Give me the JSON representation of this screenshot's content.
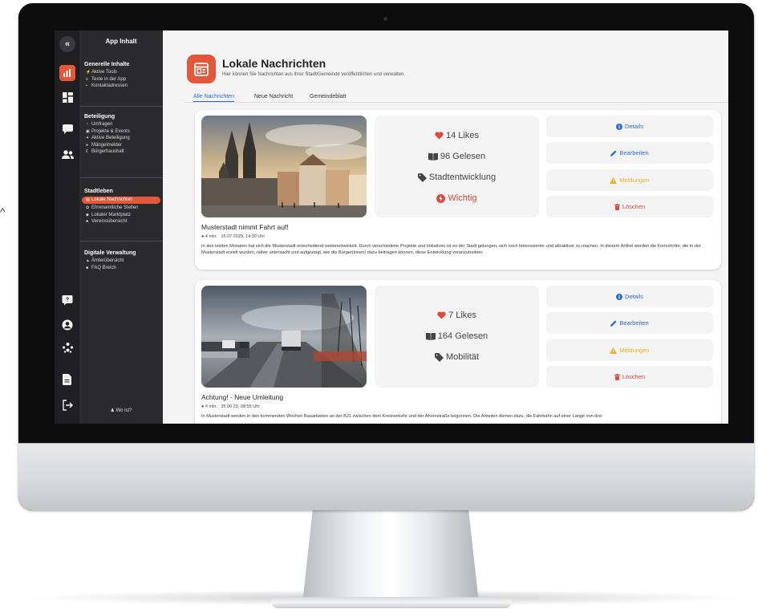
{
  "sidebar": {
    "title": "App Inhalt",
    "sections": [
      {
        "heading": "Generelle Inhalte",
        "items": [
          {
            "label": "Aktive Tools",
            "icon": "dot-icon"
          },
          {
            "label": "Texte in der App",
            "icon": "text-icon"
          },
          {
            "label": "Kontaktadressen",
            "icon": "contact-icon"
          }
        ]
      },
      {
        "heading": "Beteiligung",
        "items": [
          {
            "label": "Umfragen",
            "icon": "poll-icon"
          },
          {
            "label": "Projekte & Events",
            "icon": "calendar-icon"
          },
          {
            "label": "Aktive Beteiligung",
            "icon": "person-icon"
          },
          {
            "label": "Mängelmelder",
            "icon": "alert-icon"
          },
          {
            "label": "Bürgerhaushalt",
            "icon": "euro-icon"
          }
        ]
      },
      {
        "heading": "Stadtleben",
        "items": [
          {
            "label": "Lokale Nachrichten",
            "icon": "news-icon",
            "active": true
          },
          {
            "label": "Ehrenamtliche Stellen",
            "icon": "handshake-icon"
          },
          {
            "label": "Lokaler Marktplatz",
            "icon": "shop-icon"
          },
          {
            "label": "Vereinsübersicht",
            "icon": "group-icon"
          }
        ]
      },
      {
        "heading": "Digitale Verwaltung",
        "items": [
          {
            "label": "Ämterübersicht",
            "icon": "building-icon"
          },
          {
            "label": "FAQ Breich",
            "icon": "faq-icon"
          }
        ]
      }
    ],
    "footer": "Wo ist?"
  },
  "header": {
    "title": "Lokale Nachrichten",
    "subtitle": "Hier können Sie Nachrichten aus Ihrer Stadt/Gemeinde veröffentlichen und verwalten.",
    "tabs": [
      "Alle Nachrichten",
      "Neue Nachricht",
      "Gemeindeblatt"
    ],
    "active_tab": 0
  },
  "actions": {
    "details": "Details",
    "edit": "Bearbeiten",
    "reports": "Meldungen",
    "delete": "Löschen"
  },
  "news": [
    {
      "likes": "14 Likes",
      "reads": "96 Gelesen",
      "category": "Stadtentwicklung",
      "flag": "Wichtig",
      "title": "Musterstadt nimmt Fahrt auf!",
      "read_time": "4 min.",
      "date": "15.07.2023, 14:30 Uhr",
      "body": "In den letzten Monaten hat sich die Musterstadt entscheidend weiterentwickelt. Durch verschiedene Projekte und Initiativen ist es der Stadt gelungen, sich noch lebenswerter und attraktiver zu machen. In diesem Artikel werden die Fortschritte, die in der Musterstadt erzielt wurden, näher untersucht und aufgezeigt, wie die Bürger(innen) dazu beitragen können, diese Entwicklung voranzutreiben."
    },
    {
      "likes": "7 Likes",
      "reads": "164 Gelesen",
      "category": "Mobilität",
      "title": "Achtung! - Neue Umleitung",
      "read_time": "4 min.",
      "date": "25.06.23, 08:55 Uhr",
      "body": "In Musterstadt werden in den kommenden Wochen Bauarbeiten an der B21 zwischen dem Kreisverkehr und der Ahornstraße begonnen. Die Arbeiten dienen dazu, die Fahrbahn auf einer Länge von drei"
    }
  ],
  "colors": {
    "accent": "#e3573b",
    "link_blue": "#2f6bd6",
    "warning_yellow": "#efb31a",
    "danger_red": "#d94b3a",
    "sidebar_bg": "#2b2b2d",
    "rail_bg": "#202022"
  }
}
